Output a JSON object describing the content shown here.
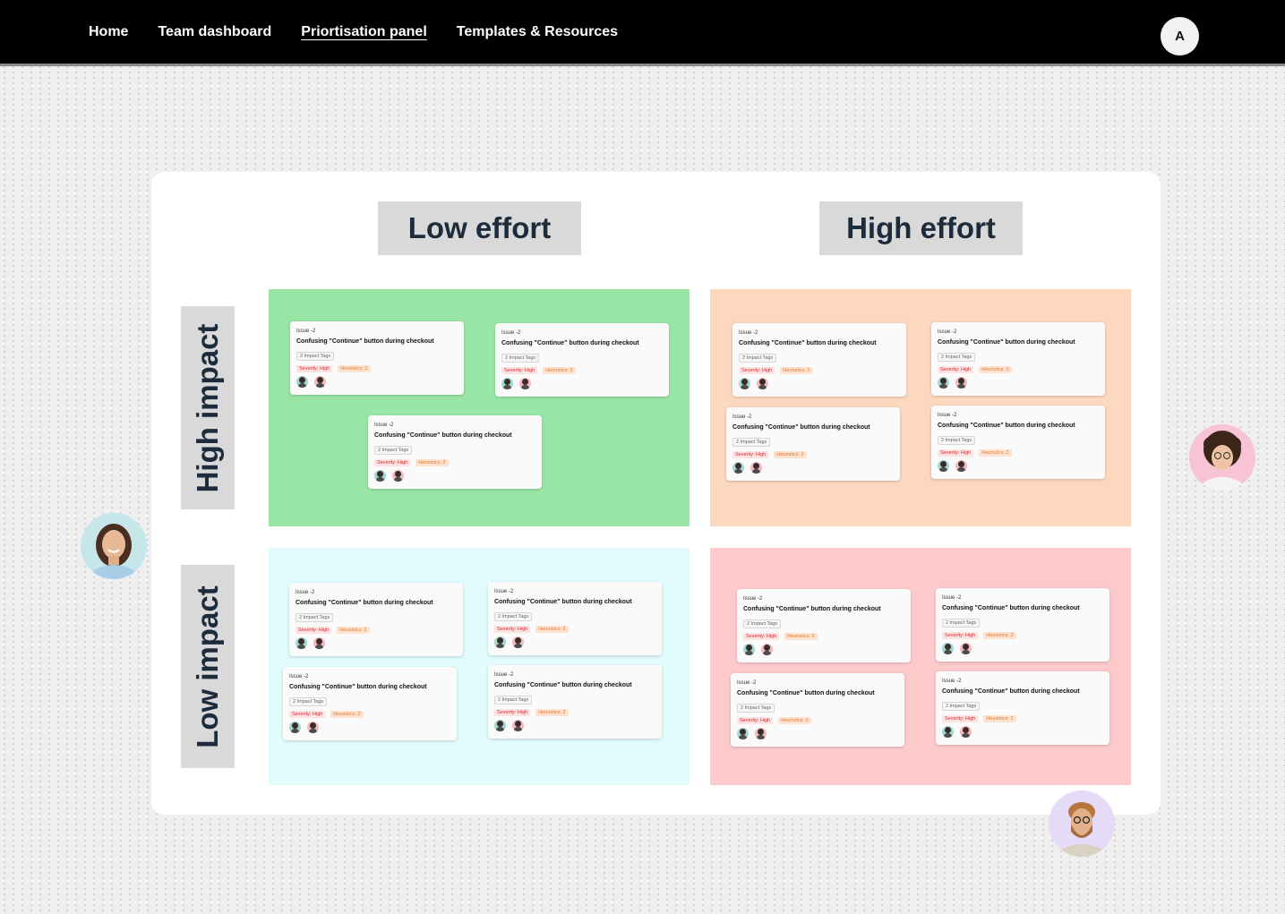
{
  "nav": {
    "items": [
      {
        "label": "Home"
      },
      {
        "label": "Team dashboard"
      },
      {
        "label": "Priortisation panel"
      },
      {
        "label": "Templates & Resources"
      }
    ],
    "active_index": 2,
    "user_initial": "A"
  },
  "board": {
    "columns": [
      {
        "label": "Low effort"
      },
      {
        "label": "High effort"
      }
    ],
    "rows": [
      {
        "label": "High impact"
      },
      {
        "label": "Low impact"
      }
    ],
    "card": {
      "issue_id": "Issue -2",
      "title": "Confusing \"Continue\" button during checkout",
      "impact_tags": "2 Impact Tags",
      "severity": "Severity: High",
      "heuristics": "Heuristics: 2"
    },
    "quadrant_colors": {
      "high_impact_low_effort": "#98e5a5",
      "high_impact_high_effort": "#fcd8be",
      "low_impact_low_effort": "#e2fcfd",
      "low_impact_high_effort": "#fdcacc"
    }
  },
  "collaborators": [
    {
      "name": "collaborator-woman-dark-hair",
      "icon": "avatar-photo"
    },
    {
      "name": "collaborator-curly-hair",
      "icon": "avatar-photo"
    },
    {
      "name": "collaborator-bearded-man",
      "icon": "avatar-photo"
    }
  ]
}
